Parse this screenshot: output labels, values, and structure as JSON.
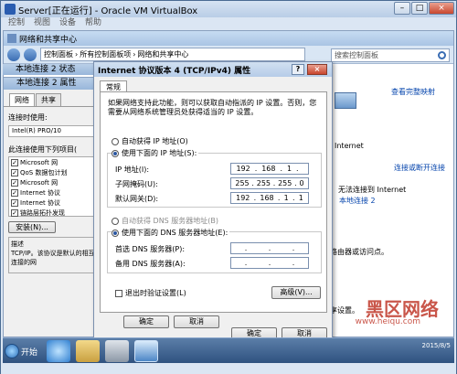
{
  "vbox": {
    "title": "Server[正在运行] - Oracle VM VirtualBox",
    "menu": [
      "控制",
      "视图",
      "设备",
      "帮助"
    ]
  },
  "nsc": {
    "title": "网络和共享中心",
    "address": [
      "控制面板",
      "所有控制面板项",
      "网络和共享中心"
    ],
    "search_placeholder": "搜索控制面板",
    "right": {
      "internet": "Internet",
      "view_full_map": "查看完整映射",
      "connect_disconnect": "连接或断开连接",
      "no_internet": "无法连接到 Internet",
      "local_conn": "本地连接 2",
      "frag1": "路由器或访问点。",
      "frag2": "。",
      "frag3": "享设置。"
    }
  },
  "lcs": {
    "title": "本地连接 2 状态"
  },
  "lcp": {
    "title": "本地连接 2 属性",
    "tabs": [
      "网络",
      "共享"
    ],
    "connect_using_label": "连接时使用:",
    "adapter": "Intel(R) PRO/10",
    "items_label": "此连接使用下列项目(",
    "items": [
      "Microsoft 网",
      "QoS 数据包计划",
      "Microsoft 网",
      "Internet 协议",
      "Internet 协议",
      "链路层拓扑发现",
      "链路层拓扑发现"
    ],
    "install_btn": "安装(N)...",
    "desc_title": "描述",
    "desc_text": "TCP/IP。该协议是默认的相互连接的网",
    "ok": "确定",
    "cancel": "取消"
  },
  "ipv4": {
    "title": "Internet 协议版本 4 (TCP/IPv4) 属性",
    "help": "?",
    "close": "×",
    "tab": "常规",
    "description": "如果网络支持此功能，则可以获取自动指派的 IP 设置。否则，您需要从网络系统管理员处获得适当的 IP 设置。",
    "auto_ip": "自动获得 IP 地址(O)",
    "manual_ip": "使用下面的 IP 地址(S):",
    "ip_label": "IP 地址(I):",
    "ip_value": [
      "192",
      "168",
      "1",
      ""
    ],
    "mask_label": "子网掩码(U):",
    "mask_value": [
      "255",
      "255",
      "255",
      "0"
    ],
    "gateway_label": "默认网关(D):",
    "gateway_value": [
      "192",
      "168",
      "1",
      "1"
    ],
    "auto_dns": "自动获得 DNS 服务器地址(B)",
    "manual_dns": "使用下面的 DNS 服务器地址(E):",
    "dns1_label": "首选 DNS 服务器(P):",
    "dns2_label": "备用 DNS 服务器(A):",
    "validate": "退出时验证设置(L)",
    "advanced": "高级(V)...",
    "ok": "确定",
    "cancel": "取消"
  },
  "taskbar": {
    "start": "开始",
    "tray_time": "2015/8/5"
  },
  "watermark": {
    "text": "黑区网络",
    "url": "www.heiqu.com"
  }
}
